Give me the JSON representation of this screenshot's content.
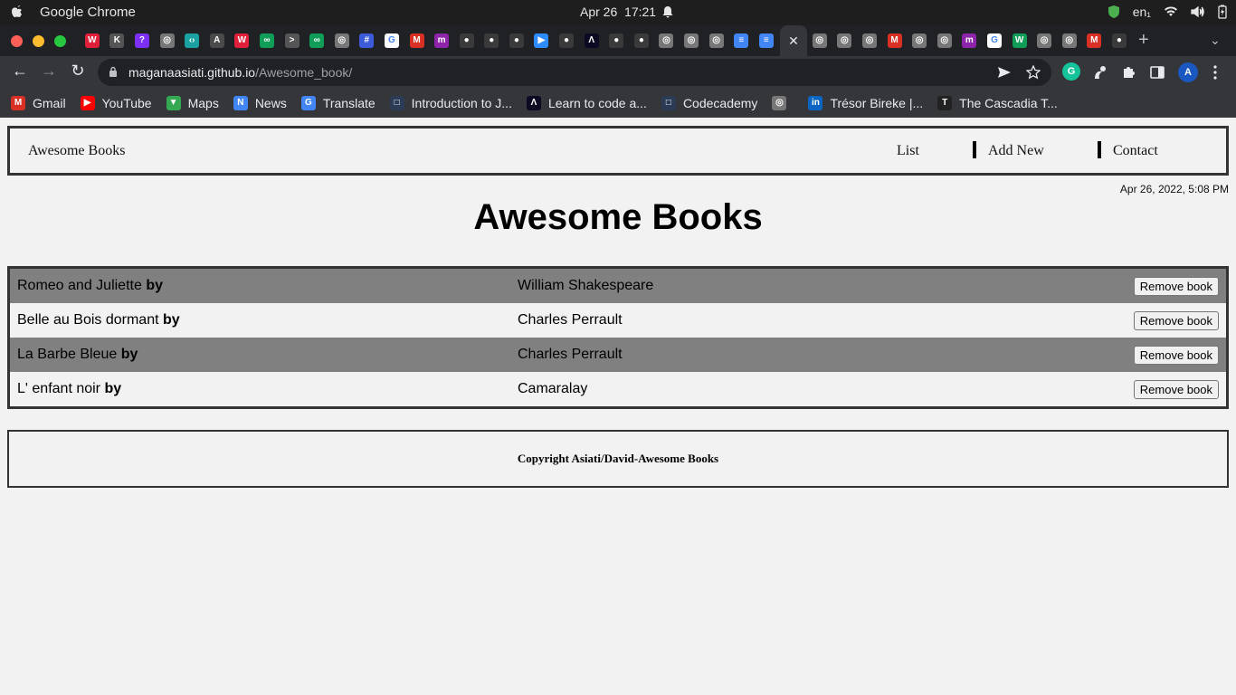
{
  "os": {
    "app_name": "Google Chrome",
    "date": "Apr 26",
    "time": "17:21",
    "lang": "en₁"
  },
  "tabs": {
    "icons": [
      {
        "name": "vivaldi-tab-icon",
        "color": "#e0203a",
        "glyph": "W"
      },
      {
        "name": "anchor-tab-icon",
        "color": "#555555",
        "glyph": "K"
      },
      {
        "name": "question-tab-icon",
        "color": "#7b2ff7",
        "glyph": "?"
      },
      {
        "name": "chrome-tab-icon",
        "color": "#777777",
        "glyph": "◎"
      },
      {
        "name": "code-tab-icon",
        "color": "#1aa2a2",
        "glyph": "‹›"
      },
      {
        "name": "a-tab-icon",
        "color": "#4a4a4a",
        "glyph": "A"
      },
      {
        "name": "vivaldi-tab-icon",
        "color": "#e0203a",
        "glyph": "W"
      },
      {
        "name": "link-tab-icon",
        "color": "#0f9d58",
        "glyph": "∞"
      },
      {
        "name": "terminal-tab-icon",
        "color": "#555555",
        "glyph": ">"
      },
      {
        "name": "link-tab-icon",
        "color": "#0f9d58",
        "glyph": "∞"
      },
      {
        "name": "chrome-tab-icon",
        "color": "#777777",
        "glyph": "◎"
      },
      {
        "name": "grid-tab-icon",
        "color": "#3b5bdb",
        "glyph": "#"
      },
      {
        "name": "google-tab-icon",
        "color": "#ffffff",
        "glyph": "G"
      },
      {
        "name": "gmail-tab-icon",
        "color": "#d93025",
        "glyph": "M"
      },
      {
        "name": "m-tab-icon",
        "color": "#8e24aa",
        "glyph": "m"
      },
      {
        "name": "github-tab-icon",
        "color": "#3a3a3a",
        "glyph": "●"
      },
      {
        "name": "github-tab-icon",
        "color": "#3a3a3a",
        "glyph": "●"
      },
      {
        "name": "github-tab-icon",
        "color": "#3a3a3a",
        "glyph": "●"
      },
      {
        "name": "zoom-tab-icon",
        "color": "#2d8cff",
        "glyph": "▶"
      },
      {
        "name": "github-tab-icon",
        "color": "#3a3a3a",
        "glyph": "●"
      },
      {
        "name": "freecodecamp-tab-icon",
        "color": "#0a0a23",
        "glyph": "Λ"
      },
      {
        "name": "github-tab-icon",
        "color": "#3a3a3a",
        "glyph": "●"
      },
      {
        "name": "github-tab-icon",
        "color": "#3a3a3a",
        "glyph": "●"
      },
      {
        "name": "globe-tab-icon",
        "color": "#777777",
        "glyph": "◎"
      },
      {
        "name": "globe-tab-icon",
        "color": "#777777",
        "glyph": "◎"
      },
      {
        "name": "globe-tab-icon",
        "color": "#777777",
        "glyph": "◎"
      },
      {
        "name": "docs-tab-icon",
        "color": "#4285f4",
        "glyph": "≡"
      },
      {
        "name": "docs-tab-icon",
        "color": "#4285f4",
        "glyph": "≡"
      }
    ],
    "active_close": "✕",
    "right_icons": [
      {
        "name": "chrome-tab-icon",
        "color": "#777777",
        "glyph": "◎"
      },
      {
        "name": "chrome-tab-icon",
        "color": "#777777",
        "glyph": "◎"
      },
      {
        "name": "chrome-tab-icon",
        "color": "#777777",
        "glyph": "◎"
      },
      {
        "name": "gmail-tab-icon",
        "color": "#d93025",
        "glyph": "M"
      },
      {
        "name": "globe-tab-icon",
        "color": "#777777",
        "glyph": "◎"
      },
      {
        "name": "globe-tab-icon",
        "color": "#777777",
        "glyph": "◎"
      },
      {
        "name": "m-tab-icon",
        "color": "#8e24aa",
        "glyph": "m"
      },
      {
        "name": "google-tab-icon",
        "color": "#ffffff",
        "glyph": "G"
      },
      {
        "name": "w-tab-icon",
        "color": "#0f9d58",
        "glyph": "W"
      },
      {
        "name": "globe-tab-icon",
        "color": "#777777",
        "glyph": "◎"
      },
      {
        "name": "chrome-tab-icon",
        "color": "#777777",
        "glyph": "◎"
      },
      {
        "name": "gmail-tab-icon",
        "color": "#d93025",
        "glyph": "M"
      },
      {
        "name": "github-tab-icon",
        "color": "#3a3a3a",
        "glyph": "●"
      }
    ],
    "new_tab": "+",
    "menu": "⌄"
  },
  "toolbar": {
    "back": "←",
    "forward": "→",
    "reload": "↻",
    "url_host": "maganaasiati.github.io",
    "url_path": "/Awesome_book/",
    "profile": "A"
  },
  "bookmarks": [
    {
      "label": "Gmail",
      "color": "#d93025",
      "glyph": "M",
      "icon": "gmail-icon"
    },
    {
      "label": "YouTube",
      "color": "#ff0000",
      "glyph": "▶",
      "icon": "youtube-icon"
    },
    {
      "label": "Maps",
      "color": "#34a853",
      "glyph": "▼",
      "icon": "maps-icon"
    },
    {
      "label": "News",
      "color": "#4285f4",
      "glyph": "N",
      "icon": "news-icon"
    },
    {
      "label": "Translate",
      "color": "#4285f4",
      "glyph": "G",
      "icon": "translate-icon"
    },
    {
      "label": "Introduction to J...",
      "color": "#2b3a55",
      "glyph": "□",
      "icon": "doc-icon"
    },
    {
      "label": "Learn to code a...",
      "color": "#0a0a23",
      "glyph": "Λ",
      "icon": "freecodecamp-icon"
    },
    {
      "label": "Codecademy",
      "color": "#2b3a55",
      "glyph": "□",
      "icon": "codecademy-icon"
    },
    {
      "label": "",
      "color": "#777777",
      "glyph": "◎",
      "icon": "globe-icon"
    },
    {
      "label": "Trésor Bireke |...",
      "color": "#0a66c2",
      "glyph": "in",
      "icon": "linkedin-icon"
    },
    {
      "label": "The Cascadia T...",
      "color": "#222222",
      "glyph": "T",
      "icon": "cascadia-icon"
    }
  ],
  "site": {
    "brand": "Awesome Books",
    "nav": [
      "List",
      "Add New",
      "Contact"
    ],
    "date": "Apr 26, 2022, 5:08 PM",
    "title": "Awesome Books",
    "by_label": "by",
    "remove_label": "Remove book",
    "books": [
      {
        "title": "Romeo and Juliette",
        "author": "William Shakespeare"
      },
      {
        "title": "Belle au Bois dormant",
        "author": "Charles Perrault"
      },
      {
        "title": "La Barbe Bleue",
        "author": "Charles Perrault"
      },
      {
        "title": "L' enfant noir",
        "author": "Camaralay"
      }
    ],
    "footer": "Copyright Asiati/David-Awesome Books"
  }
}
